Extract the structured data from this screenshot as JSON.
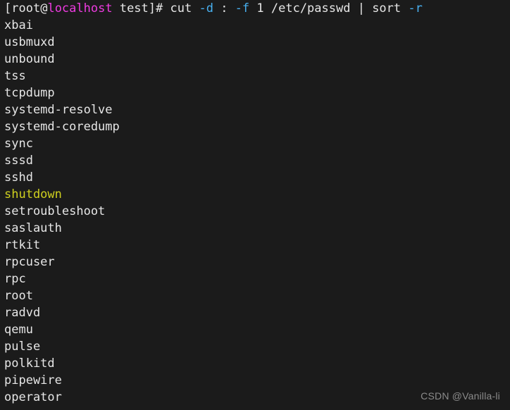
{
  "terminal": {
    "background_color": "#1b1b1b",
    "foreground_color": "#e6e6e6",
    "accent_colors": {
      "hostname": "#ee3be0",
      "option_flag": "#48b0f0",
      "highlighted_entry": "#cfd01f"
    },
    "prompt_line": {
      "bracket_open": "[",
      "user": "root",
      "at": "@",
      "host": "localhost",
      "space": " ",
      "directory": "test",
      "bracket_close": "]",
      "sigil": "# ",
      "command_name": "cut ",
      "flag_d": "-d",
      "delimiter": " : ",
      "flag_f": "-f",
      "field": " 1 ",
      "file_path": "/etc/passwd",
      "pipe": " | ",
      "second_command": "sort ",
      "flag_r": "-r"
    },
    "output_lines": [
      {
        "text": "xbai",
        "color": "default"
      },
      {
        "text": "usbmuxd",
        "color": "default"
      },
      {
        "text": "unbound",
        "color": "default"
      },
      {
        "text": "tss",
        "color": "default"
      },
      {
        "text": "tcpdump",
        "color": "default"
      },
      {
        "text": "systemd-resolve",
        "color": "default"
      },
      {
        "text": "systemd-coredump",
        "color": "default"
      },
      {
        "text": "sync",
        "color": "default"
      },
      {
        "text": "sssd",
        "color": "default"
      },
      {
        "text": "sshd",
        "color": "default"
      },
      {
        "text": "shutdown",
        "color": "yellow"
      },
      {
        "text": "setroubleshoot",
        "color": "default"
      },
      {
        "text": "saslauth",
        "color": "default"
      },
      {
        "text": "rtkit",
        "color": "default"
      },
      {
        "text": "rpcuser",
        "color": "default"
      },
      {
        "text": "rpc",
        "color": "default"
      },
      {
        "text": "root",
        "color": "default"
      },
      {
        "text": "radvd",
        "color": "default"
      },
      {
        "text": "qemu",
        "color": "default"
      },
      {
        "text": "pulse",
        "color": "default"
      },
      {
        "text": "polkitd",
        "color": "default"
      },
      {
        "text": "pipewire",
        "color": "default"
      },
      {
        "text": "operator",
        "color": "default"
      }
    ]
  },
  "watermark": {
    "text": "CSDN @Vanilla-li"
  }
}
